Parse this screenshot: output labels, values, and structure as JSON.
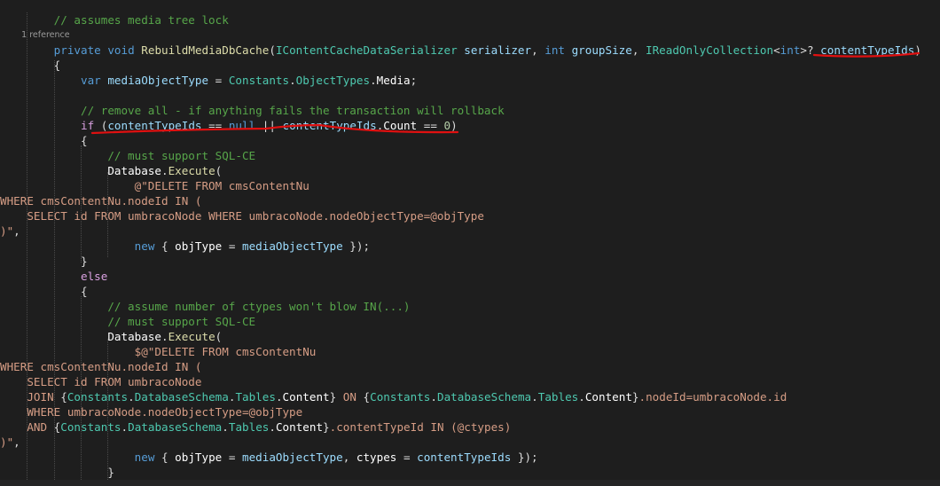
{
  "theme": {
    "background": "#1e1e1e",
    "annotation_color": "#e01010",
    "token_colors": {
      "k": "#569cd6",
      "kc": "#d8a0df",
      "t": "#4ec9b0",
      "tn": "#4ec9b0",
      "f": "#dcdcaa",
      "p": "#9cdcfe",
      "l": "#9cdcfe",
      "c": "#57a64a",
      "s": "#d69d85",
      "n": "#b5cea8",
      "pl": "#dcdcdc",
      "w": "#ffffff",
      "r": "#9a9a9a"
    }
  },
  "code": [
    [
      [
        "c",
        "        // assumes media tree lock"
      ]
    ],
    [
      [
        "r",
        "        1 reference"
      ]
    ],
    [
      [
        "pl",
        "        "
      ],
      [
        "k",
        "private"
      ],
      [
        "pl",
        " "
      ],
      [
        "k",
        "void"
      ],
      [
        "pl",
        " "
      ],
      [
        "f",
        "RebuildMediaDbCache"
      ],
      [
        "pl",
        "("
      ],
      [
        "t",
        "IContentCacheDataSerializer"
      ],
      [
        "pl",
        " "
      ],
      [
        "p",
        "serializer"
      ],
      [
        "pl",
        ", "
      ],
      [
        "k",
        "int"
      ],
      [
        "pl",
        " "
      ],
      [
        "p",
        "groupSize"
      ],
      [
        "pl",
        ", "
      ],
      [
        "t",
        "IReadOnlyCollection"
      ],
      [
        "pl",
        "<"
      ],
      [
        "k",
        "int"
      ],
      [
        "pl",
        ">? "
      ],
      [
        "p",
        "contentTypeIds"
      ],
      [
        "pl",
        ")"
      ]
    ],
    [
      [
        "pl",
        "        {"
      ]
    ],
    [
      [
        "pl",
        "            "
      ],
      [
        "k",
        "var"
      ],
      [
        "pl",
        " "
      ],
      [
        "l",
        "mediaObjectType"
      ],
      [
        "pl",
        " = "
      ],
      [
        "t",
        "Constants"
      ],
      [
        "pl",
        "."
      ],
      [
        "t",
        "ObjectTypes"
      ],
      [
        "pl",
        "."
      ],
      [
        "w",
        "Media"
      ],
      [
        "pl",
        ";"
      ]
    ],
    [
      [
        "pl",
        ""
      ]
    ],
    [
      [
        "c",
        "            // remove all - if anything fails the transaction will rollback"
      ]
    ],
    [
      [
        "pl",
        "            "
      ],
      [
        "kc",
        "if"
      ],
      [
        "pl",
        " ("
      ],
      [
        "p",
        "contentTypeIds"
      ],
      [
        "pl",
        " == "
      ],
      [
        "k",
        "null"
      ],
      [
        "pl",
        " || "
      ],
      [
        "p",
        "contentTypeIds"
      ],
      [
        "pl",
        "."
      ],
      [
        "w",
        "Count"
      ],
      [
        "pl",
        " == "
      ],
      [
        "n",
        "0"
      ],
      [
        "pl",
        ")"
      ]
    ],
    [
      [
        "pl",
        "            {"
      ]
    ],
    [
      [
        "c",
        "                // must support SQL-CE"
      ]
    ],
    [
      [
        "pl",
        "                "
      ],
      [
        "w",
        "Database"
      ],
      [
        "pl",
        "."
      ],
      [
        "f",
        "Execute"
      ],
      [
        "pl",
        "("
      ]
    ],
    [
      [
        "s",
        "                    @\"DELETE FROM cmsContentNu"
      ]
    ],
    [
      [
        "s",
        "WHERE cmsContentNu.nodeId IN ("
      ]
    ],
    [
      [
        "s",
        "    SELECT id FROM umbracoNode WHERE umbracoNode.nodeObjectType=@objType"
      ]
    ],
    [
      [
        "s",
        ")\""
      ],
      [
        "pl",
        ","
      ]
    ],
    [
      [
        "pl",
        "                    "
      ],
      [
        "k",
        "new"
      ],
      [
        "pl",
        " { "
      ],
      [
        "w",
        "objType"
      ],
      [
        "pl",
        " = "
      ],
      [
        "l",
        "mediaObjectType"
      ],
      [
        "pl",
        " });"
      ]
    ],
    [
      [
        "pl",
        "            }"
      ]
    ],
    [
      [
        "pl",
        "            "
      ],
      [
        "kc",
        "else"
      ]
    ],
    [
      [
        "pl",
        "            {"
      ]
    ],
    [
      [
        "c",
        "                // assume number of ctypes won't blow IN(...)"
      ]
    ],
    [
      [
        "c",
        "                // must support SQL-CE"
      ]
    ],
    [
      [
        "pl",
        "                "
      ],
      [
        "w",
        "Database"
      ],
      [
        "pl",
        "."
      ],
      [
        "f",
        "Execute"
      ],
      [
        "pl",
        "("
      ]
    ],
    [
      [
        "s",
        "                    $@\"DELETE FROM cmsContentNu"
      ]
    ],
    [
      [
        "s",
        "WHERE cmsContentNu.nodeId IN ("
      ]
    ],
    [
      [
        "s",
        "    SELECT id FROM umbracoNode"
      ]
    ],
    [
      [
        "s",
        "    JOIN "
      ],
      [
        "pl",
        "{"
      ],
      [
        "t",
        "Constants"
      ],
      [
        "pl",
        "."
      ],
      [
        "t",
        "DatabaseSchema"
      ],
      [
        "pl",
        "."
      ],
      [
        "t",
        "Tables"
      ],
      [
        "pl",
        "."
      ],
      [
        "w",
        "Content"
      ],
      [
        "pl",
        "}"
      ],
      [
        "s",
        " ON "
      ],
      [
        "pl",
        "{"
      ],
      [
        "t",
        "Constants"
      ],
      [
        "pl",
        "."
      ],
      [
        "t",
        "DatabaseSchema"
      ],
      [
        "pl",
        "."
      ],
      [
        "t",
        "Tables"
      ],
      [
        "pl",
        "."
      ],
      [
        "w",
        "Content"
      ],
      [
        "pl",
        "}"
      ],
      [
        "s",
        ".nodeId=umbracoNode.id"
      ]
    ],
    [
      [
        "s",
        "    WHERE umbracoNode.nodeObjectType=@objType"
      ]
    ],
    [
      [
        "s",
        "    AND "
      ],
      [
        "pl",
        "{"
      ],
      [
        "t",
        "Constants"
      ],
      [
        "pl",
        "."
      ],
      [
        "t",
        "DatabaseSchema"
      ],
      [
        "pl",
        "."
      ],
      [
        "t",
        "Tables"
      ],
      [
        "pl",
        "."
      ],
      [
        "w",
        "Content"
      ],
      [
        "pl",
        "}"
      ],
      [
        "s",
        ".contentTypeId IN (@ctypes)"
      ]
    ],
    [
      [
        "s",
        ")\""
      ],
      [
        "pl",
        ","
      ]
    ],
    [
      [
        "pl",
        "                    "
      ],
      [
        "k",
        "new"
      ],
      [
        "pl",
        " { "
      ],
      [
        "w",
        "objType"
      ],
      [
        "pl",
        " = "
      ],
      [
        "l",
        "mediaObjectType"
      ],
      [
        "pl",
        ", "
      ],
      [
        "w",
        "ctypes"
      ],
      [
        "pl",
        " = "
      ],
      [
        "p",
        "contentTypeIds"
      ],
      [
        "pl",
        " });"
      ]
    ],
    [
      [
        "pl",
        "                }"
      ]
    ]
  ]
}
